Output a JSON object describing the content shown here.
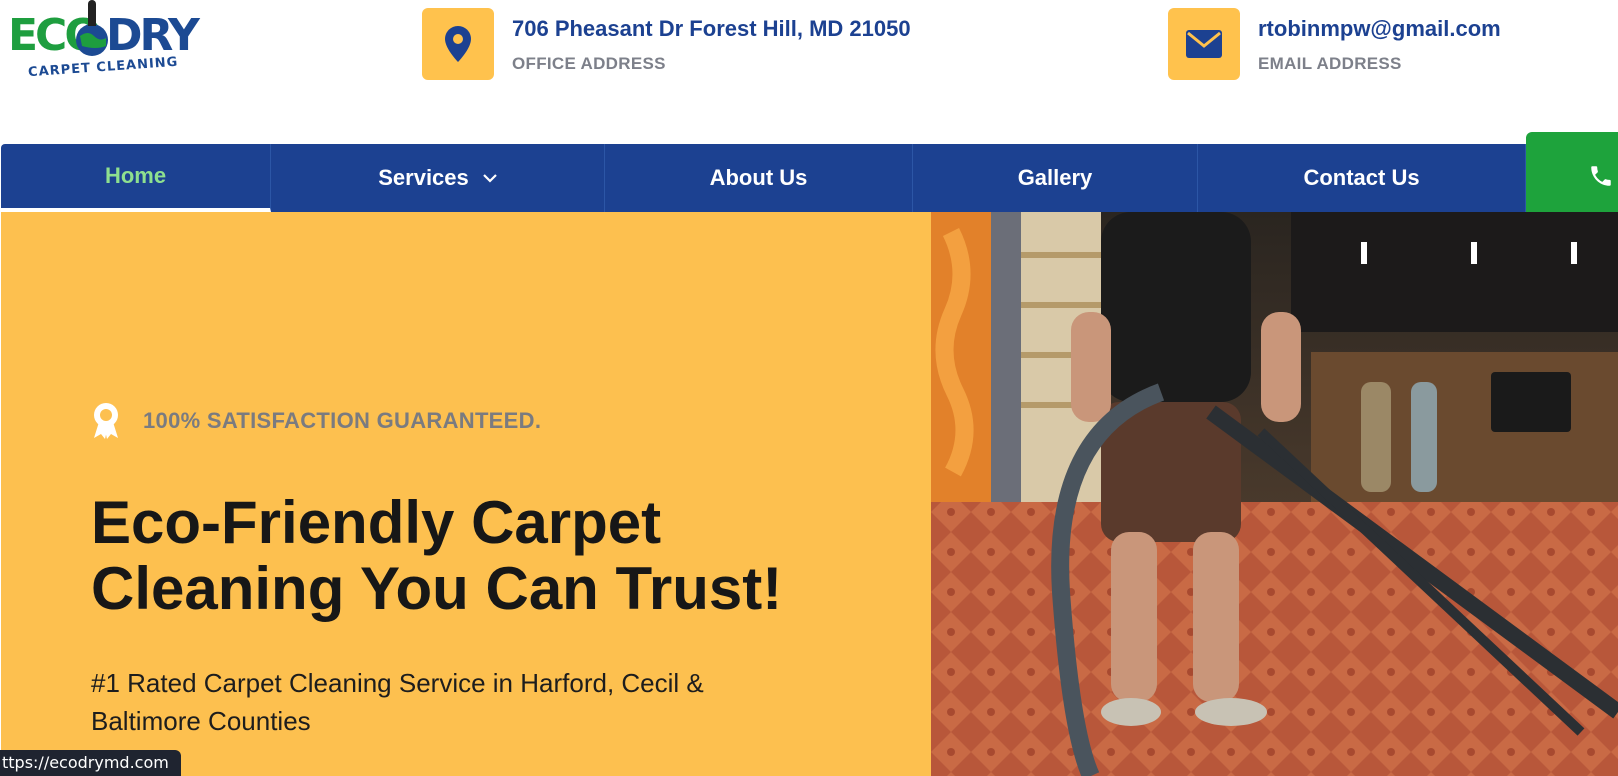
{
  "logo": {
    "eco": "ECO",
    "dry": "DRY",
    "sub": "CARPET CLEANING"
  },
  "header": {
    "address": {
      "title": "706 Pheasant Dr Forest Hill, MD 21050",
      "label": "OFFICE ADDRESS",
      "icon": "location-pin-icon"
    },
    "email": {
      "title": "rtobinmpw@gmail.com",
      "label": "EMAIL ADDRESS",
      "icon": "envelope-icon"
    }
  },
  "nav": {
    "items": [
      {
        "label": "Home",
        "active": true
      },
      {
        "label": "Services",
        "dropdown": true
      },
      {
        "label": "About Us"
      },
      {
        "label": "Gallery"
      },
      {
        "label": "Contact Us"
      }
    ],
    "call_icon": "phone-icon"
  },
  "hero": {
    "tagline": "100% SATISFACTION GUARANTEED.",
    "title": "Eco-Friendly Carpet Cleaning You Can Trust!",
    "description": "#1 Rated Carpet Cleaning Service in Harford, Cecil & Baltimore Counties"
  },
  "status_bar": {
    "url": "ttps://ecodrymd.com"
  },
  "colors": {
    "brand_blue": "#1c4191",
    "accent_yellow": "#fdc04f",
    "brand_green": "#1ea33c",
    "active_nav": "#8ee08f"
  }
}
